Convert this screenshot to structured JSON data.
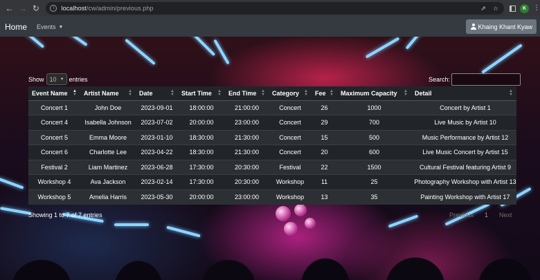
{
  "browser": {
    "url_host": "localhost",
    "url_path": "/cw/admin/previous.php",
    "profile_initial": "K"
  },
  "navbar": {
    "brand": "Home",
    "events_label": "Events",
    "user_name": "Khaing Khant Kyaw"
  },
  "controls": {
    "show_label": "Show",
    "page_length": "10",
    "entries_label": "entries",
    "search_label": "Search:",
    "info": "Showing 1 to 7 of 7 entries",
    "previous": "Previous",
    "page": "1",
    "next": "Next"
  },
  "table": {
    "columns": [
      "Event Name",
      "Artist Name",
      "Date",
      "Start Time",
      "End Time",
      "Category",
      "Fee",
      "Maximum Capacity",
      "Detail"
    ],
    "sorted_column": "Event Name",
    "sort_direction": "ascending",
    "rows": [
      [
        "Concert 1",
        "John Doe",
        "2023-09-01",
        "18:00:00",
        "21:00:00",
        "Concert",
        "26",
        "1000",
        "Concert by Artist 1"
      ],
      [
        "Concert 4",
        "Isabella Johnson",
        "2023-07-02",
        "20:00:00",
        "23:00:00",
        "Concert",
        "29",
        "700",
        "Live Music by Artist 10"
      ],
      [
        "Concert 5",
        "Emma Moore",
        "2023-01-10",
        "18:30:00",
        "21:30:00",
        "Concert",
        "15",
        "500",
        "Music Performance by Artist 12"
      ],
      [
        "Concert 6",
        "Charlotte Lee",
        "2023-04-22",
        "18:30:00",
        "21:30:00",
        "Concert",
        "20",
        "600",
        "Live Music Concert by Artist 15"
      ],
      [
        "Festival 2",
        "Liam Martinez",
        "2023-06-28",
        "17:30:00",
        "20:30:00",
        "Festival",
        "22",
        "1500",
        "Cultural Festival featuring Artist 9"
      ],
      [
        "Workshop 4",
        "Ava Jackson",
        "2023-02-14",
        "17:30:00",
        "20:30:00",
        "Workshop",
        "11",
        "25",
        "Photography Workshop with Artist 13"
      ],
      [
        "Workshop 5",
        "Amelia Harris",
        "2023-05-30",
        "20:00:00",
        "23:00:00",
        "Workshop",
        "13",
        "35",
        "Painting Workshop with Artist 17"
      ]
    ]
  }
}
